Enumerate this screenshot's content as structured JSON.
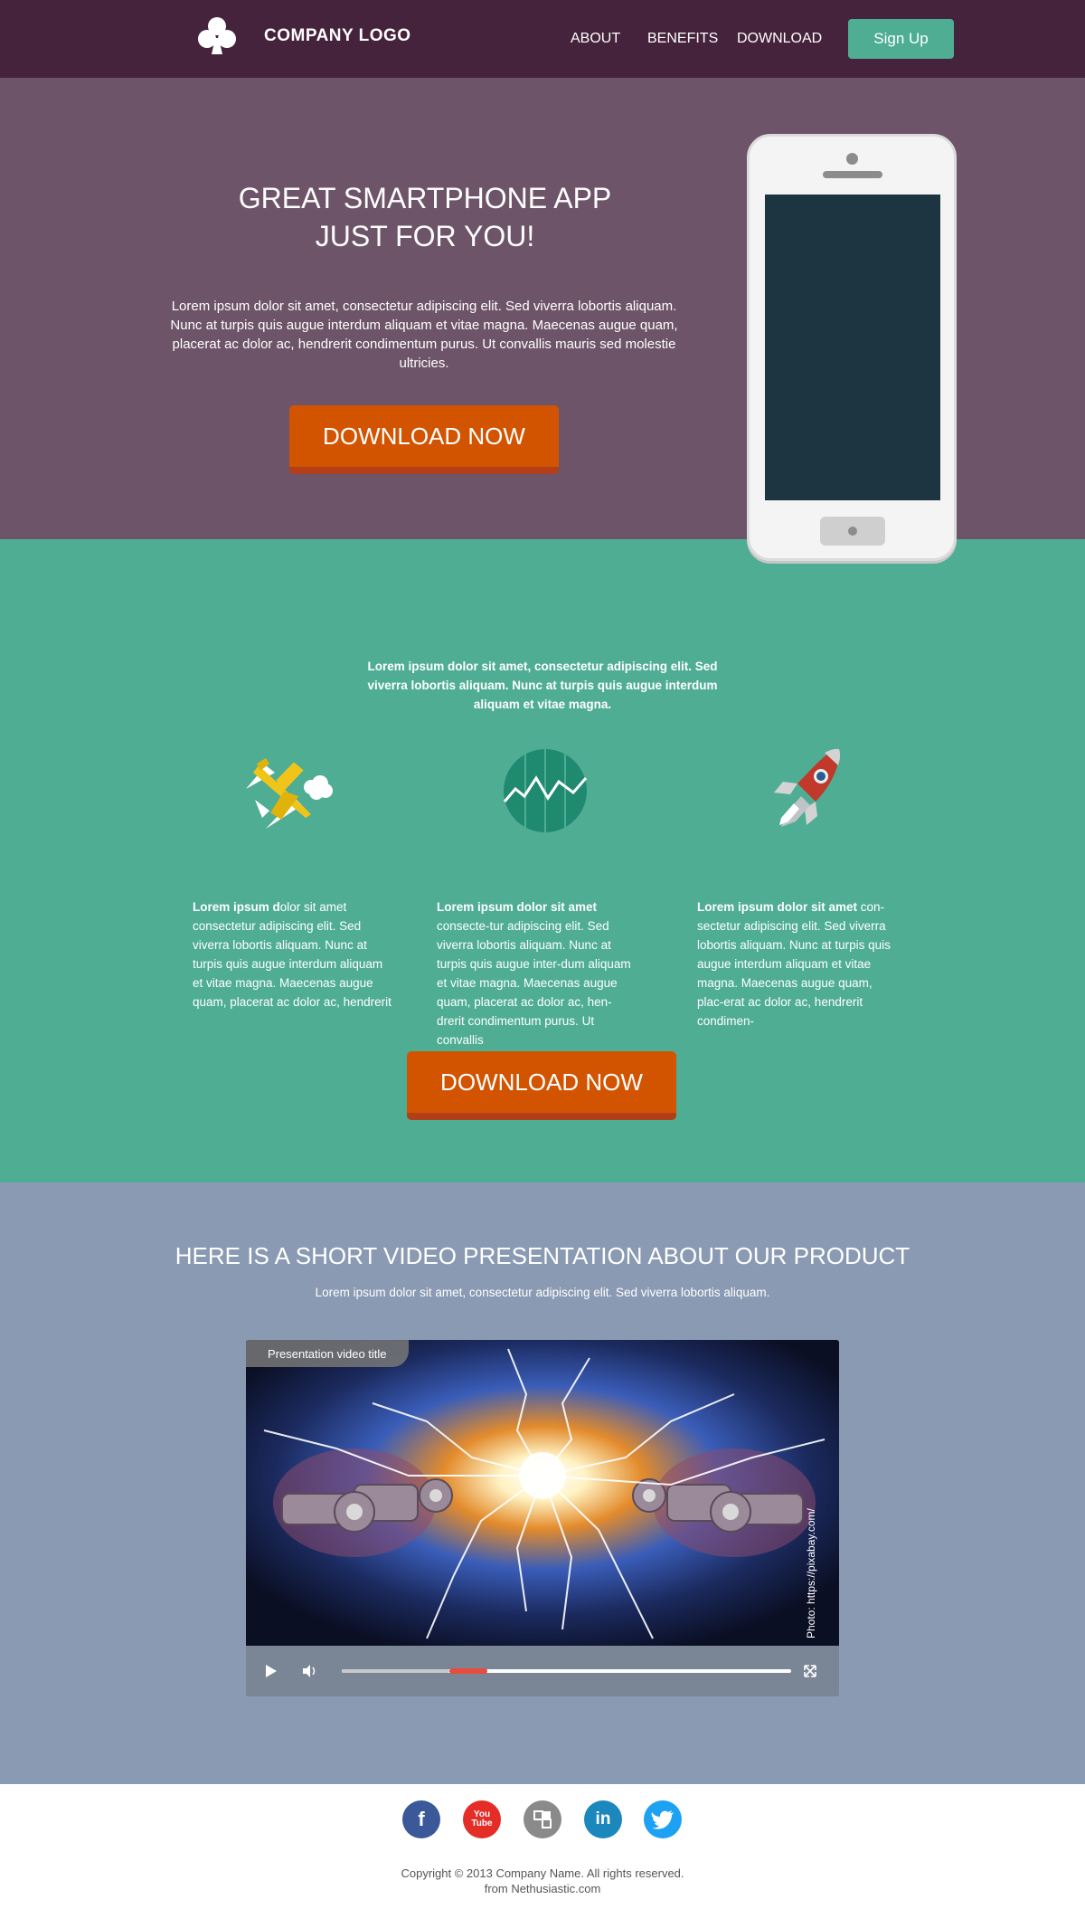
{
  "header": {
    "logo_text": "COMPANY LOGO",
    "nav": [
      "ABOUT",
      "BENEFITS",
      "DOWNLOAD"
    ],
    "signup_label": "Sign Up",
    "colors": {
      "bar": "#45233c",
      "accent": "#4fad94"
    }
  },
  "hero": {
    "title_line1": "GREAT SMARTPHONE APP",
    "title_line2": "JUST FOR YOU!",
    "text": "Lorem ipsum dolor sit amet, consectetur adipiscing elit. Sed viverra lobortis aliquam. Nunc at turpis quis augue interdum aliquam et vitae magna. Maecenas augue quam, placerat ac dolor ac, hendrerit condimentum purus. Ut convallis mauris sed molestie ultricies.",
    "cta_label": "DOWNLOAD NOW"
  },
  "features": {
    "intro": "Lorem ipsum dolor sit amet, consectetur adipiscing elit. Sed viverra lobortis aliquam. Nunc at turpis quis augue interdum aliquam et vitae magna.",
    "icons": [
      "airplane-icon",
      "chart-icon",
      "rocket-icon"
    ],
    "columns": [
      {
        "bold": "Lorem ipsum d",
        "text": "olor sit amet consectetur adipiscing elit. Sed viverra lobortis aliquam. Nunc at turpis quis augue interdum aliquam et vitae magna. Maecenas augue quam, placerat ac dolor ac, hendrerit"
      },
      {
        "bold": "Lorem ipsum dolor sit amet",
        "text": " consecte-tur adipiscing elit. Sed viverra lobortis aliquam. Nunc at turpis quis augue inter-dum aliquam et vitae magna. Maecenas augue quam, placerat ac dolor ac, hen-drerit condimentum purus. Ut convallis"
      },
      {
        "bold": "Lorem ipsum dolor sit amet",
        "text": " con-sectetur adipiscing elit. Sed viverra lobortis aliquam. Nunc at turpis quis augue interdum aliquam et vitae magna. Maecenas augue quam, plac-erat ac dolor ac, hendrerit condimen-"
      }
    ],
    "cta_label": "DOWNLOAD NOW"
  },
  "video": {
    "title": "HERE IS A SHORT VIDEO PRESENTATION ABOUT OUR PRODUCT",
    "subtitle": "Lorem ipsum dolor sit amet, consectetur adipiscing elit. Sed viverra lobortis aliquam.",
    "player_title": "Presentation video title",
    "photo_credit": "Photo: https://pixabay.com/",
    "progress": 0.24
  },
  "footer": {
    "social": [
      {
        "name": "facebook",
        "label": "f",
        "color": "#3b5998"
      },
      {
        "name": "youtube",
        "label": "You Tube",
        "color": "#e52d27"
      },
      {
        "name": "delicious",
        "label": "",
        "color": "#8a8a8a"
      },
      {
        "name": "linkedin",
        "label": "in",
        "color": "#1c87bd"
      },
      {
        "name": "twitter",
        "label": "",
        "color": "#1da1f2"
      }
    ],
    "copyright": "Copyright © 2013 Company Name. All rights reserved.",
    "credit": "from Nethusiastic.com"
  }
}
